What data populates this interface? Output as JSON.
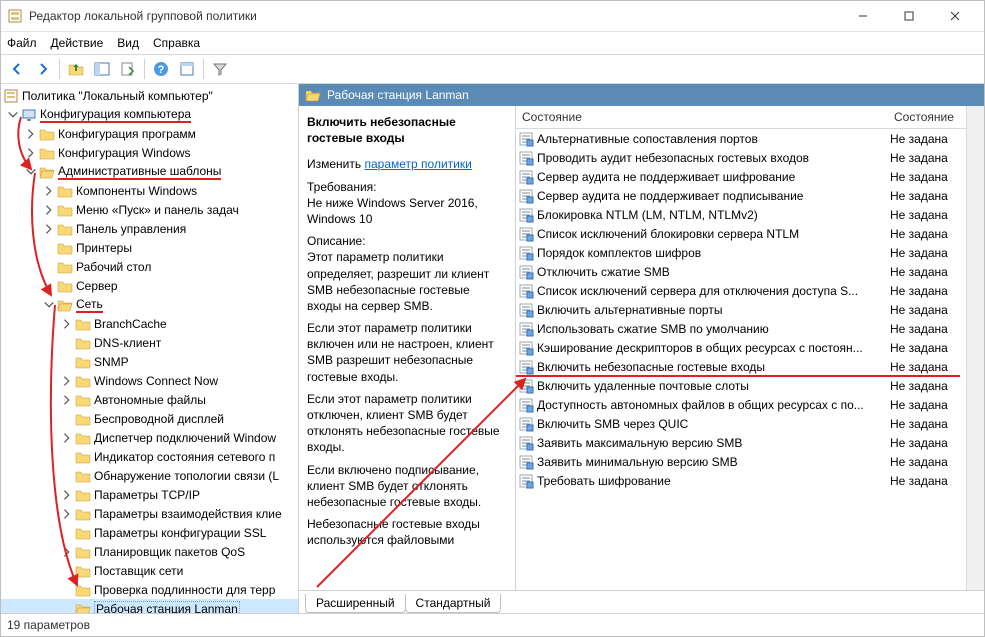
{
  "window": {
    "title": "Редактор локальной групповой политики"
  },
  "menu": {
    "file": "Файл",
    "action": "Действие",
    "view": "Вид",
    "help": "Справка"
  },
  "tree": {
    "root": "Политика \"Локальный компьютер\"",
    "computer": "Конфигурация компьютера",
    "softcfg": "Конфигурация программ",
    "wincfg": "Конфигурация Windows",
    "adm": "Административные шаблоны",
    "compWin": "Компоненты Windows",
    "startMenu": "Меню «Пуск» и панель задач",
    "ctrlPanel": "Панель управления",
    "printers": "Принтеры",
    "desktop": "Рабочий стол",
    "server": "Сервер",
    "network": "Сеть",
    "items": [
      "BranchCache",
      "DNS-клиент",
      "SNMP",
      "Windows Connect Now",
      "Автономные файлы",
      "Беспроводной дисплей",
      "Диспетчер подключений Window",
      "Индикатор состояния сетевого п",
      "Обнаружение топологии связи (L",
      "Параметры TCP/IP",
      "Параметры взаимодействия клие",
      "Параметры конфигурации SSL",
      "Планировщик пакетов QoS",
      "Поставщик сети",
      "Проверка подлинности для терр"
    ],
    "lanman": "Рабочая станция Lanman"
  },
  "headerTitle": "Рабочая станция Lanman",
  "desc": {
    "title": "Включить небезопасные гостевые входы",
    "changeLabel": "Изменить",
    "link": "параметр политики",
    "reqLabel": "Требования:",
    "req": "Не ниже Windows Server 2016, Windows 10",
    "descLabel": "Описание:",
    "p1": "Этот параметр политики определяет, разрешит ли клиент SMB небезопасные гостевые входы на сервер SMB.",
    "p2": "Если этот параметр политики включен или не настроен, клиент SMB разрешит небезопасные гостевые входы.",
    "p3": "Если этот параметр политики отключен, клиент SMB будет отклонять небезопасные гостевые входы.",
    "p4": "Если включено подписывание, клиент SMB будет отклонять небезопасные гостевые входы.",
    "p5": "Небезопасные гостевые входы используются файловыми"
  },
  "columns": {
    "c1": "Состояние",
    "c2": "Состояние"
  },
  "settings": [
    {
      "n": "Альтернативные сопоставления портов",
      "s": "Не задана"
    },
    {
      "n": "Проводить аудит небезопасных гостевых входов",
      "s": "Не задана"
    },
    {
      "n": "Сервер аудита не поддерживает шифрование",
      "s": "Не задана"
    },
    {
      "n": "Сервер аудита не поддерживает подписывание",
      "s": "Не задана"
    },
    {
      "n": "Блокировка NTLM (LM, NTLM, NTLMv2)",
      "s": "Не задана"
    },
    {
      "n": "Список исключений блокировки сервера NTLM",
      "s": "Не задана"
    },
    {
      "n": "Порядок комплектов шифров",
      "s": "Не задана"
    },
    {
      "n": "Отключить сжатие SMB",
      "s": "Не задана"
    },
    {
      "n": "Список исключений сервера для отключения доступа S...",
      "s": "Не задана"
    },
    {
      "n": "Включить альтернативные порты",
      "s": "Не задана"
    },
    {
      "n": "Использовать сжатие SMB по умолчанию",
      "s": "Не задана"
    },
    {
      "n": "Кэширование дескрипторов в общих ресурсах с постоян...",
      "s": "Не задана"
    },
    {
      "n": "Включить небезопасные гостевые входы",
      "s": "Не задана",
      "hl": true
    },
    {
      "n": "Включить удаленные почтовые слоты",
      "s": "Не задана"
    },
    {
      "n": "Доступность автономных файлов в общих ресурсах с по...",
      "s": "Не задана"
    },
    {
      "n": "Включить SMB через QUIC",
      "s": "Не задана"
    },
    {
      "n": "Заявить максимальную версию SMB",
      "s": "Не задана"
    },
    {
      "n": "Заявить минимальную версию SMB",
      "s": "Не задана"
    },
    {
      "n": "Требовать шифрование",
      "s": "Не задана"
    }
  ],
  "tabs": {
    "ext": "Расширенный",
    "std": "Стандартный"
  },
  "status": "19 параметров"
}
